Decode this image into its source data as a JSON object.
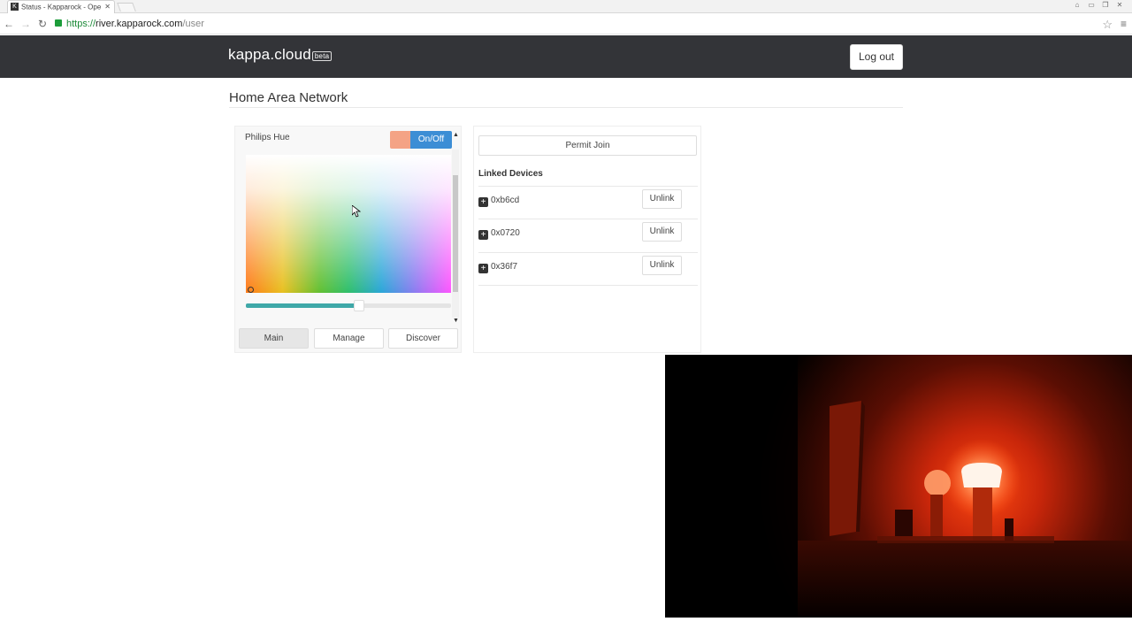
{
  "browser": {
    "tab_title": "Status - Kapparock - Ope",
    "tab_favicon": "K",
    "url_scheme": "https://",
    "url_host": "river.kapparock.com",
    "url_path": "/user"
  },
  "navbar": {
    "brand": "kappa.cloud",
    "brand_badge": "beta",
    "logout_label": "Log out"
  },
  "page": {
    "title": "Home Area Network"
  },
  "device_panel": {
    "device_name": "Philips Hue",
    "onoff_label": "On/Off",
    "swatch_color": "#f4a385",
    "brightness": 0.55,
    "tabs": [
      {
        "label": "Main",
        "active": true
      },
      {
        "label": "Manage",
        "active": false
      },
      {
        "label": "Discover",
        "active": false
      }
    ]
  },
  "linked_panel": {
    "permit_join_label": "Permit Join",
    "title": "Linked Devices",
    "devices": [
      {
        "address": "0xb6cd",
        "action": "Unlink"
      },
      {
        "address": "0x0720",
        "action": "Unlink"
      },
      {
        "address": "0x36f7",
        "action": "Unlink"
      }
    ]
  },
  "colors": {
    "navbar_bg": "#333438",
    "onoff_bg": "#3c8ed5",
    "slider_fill": "#3fa8a8"
  }
}
